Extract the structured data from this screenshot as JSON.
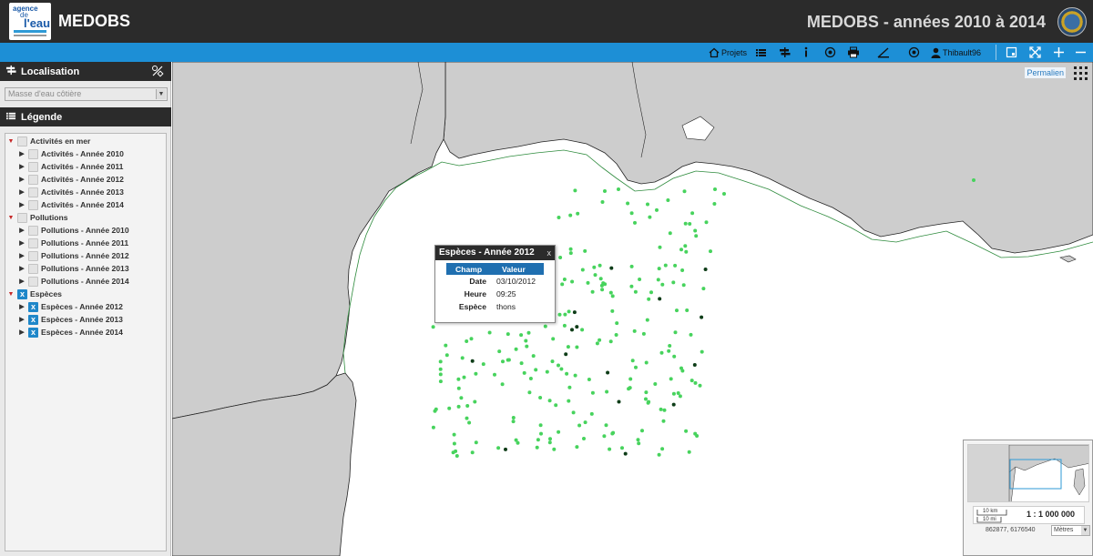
{
  "header": {
    "logo_line1": "agence",
    "logo_line2": "de",
    "logo_line3": "l'eau",
    "app_title": "MEDOBS",
    "site_title": "MEDOBS - années 2010 à 2014"
  },
  "toolbar": {
    "projets_label": "Projets",
    "user_label": "Thibault96"
  },
  "localisation": {
    "title": "Localisation",
    "select_value": "Masse d'eau côtière"
  },
  "legende": {
    "title": "Légende",
    "groups": [
      {
        "label": "Activités en mer",
        "checked": false,
        "items": [
          {
            "label": "Activités - Année 2010",
            "checked": false
          },
          {
            "label": "Activités - Année 2011",
            "checked": false
          },
          {
            "label": "Activités - Année 2012",
            "checked": false
          },
          {
            "label": "Activités - Année 2013",
            "checked": false
          },
          {
            "label": "Activités - Année 2014",
            "checked": false
          }
        ]
      },
      {
        "label": "Pollutions",
        "checked": false,
        "items": [
          {
            "label": "Pollutions - Année 2010",
            "checked": false
          },
          {
            "label": "Pollutions - Année 2011",
            "checked": false
          },
          {
            "label": "Pollutions - Année 2012",
            "checked": false
          },
          {
            "label": "Pollutions - Année 2013",
            "checked": false
          },
          {
            "label": "Pollutions - Année 2014",
            "checked": false
          }
        ]
      },
      {
        "label": "Espèces",
        "checked": true,
        "items": [
          {
            "label": "Espèces - Année 2012",
            "checked": true
          },
          {
            "label": "Espèces - Année 2013",
            "checked": true
          },
          {
            "label": "Espèces - Année 2014",
            "checked": true
          }
        ]
      }
    ]
  },
  "map": {
    "permalien": "Permalien"
  },
  "popup": {
    "title": "Espèces - Année 2012",
    "close": "x",
    "col_field": "Champ",
    "col_value": "Valeur",
    "rows": [
      {
        "field": "Date",
        "value": "03/10/2012"
      },
      {
        "field": "Heure",
        "value": "09:25"
      },
      {
        "field": "Espèce",
        "value": "thons"
      }
    ]
  },
  "overview": {
    "scale_km": "10 km",
    "scale_mi": "10 mi",
    "ratio": "1 : 1 000 000",
    "coords": "862877, 6176540",
    "units": "Mètres"
  },
  "colors": {
    "header_bg": "#2b2b2b",
    "toolbar_bg": "#1d8fd6",
    "land": "#cdcdcd",
    "observation_light": "#47d35d",
    "observation_dark": "#0e3d18"
  }
}
